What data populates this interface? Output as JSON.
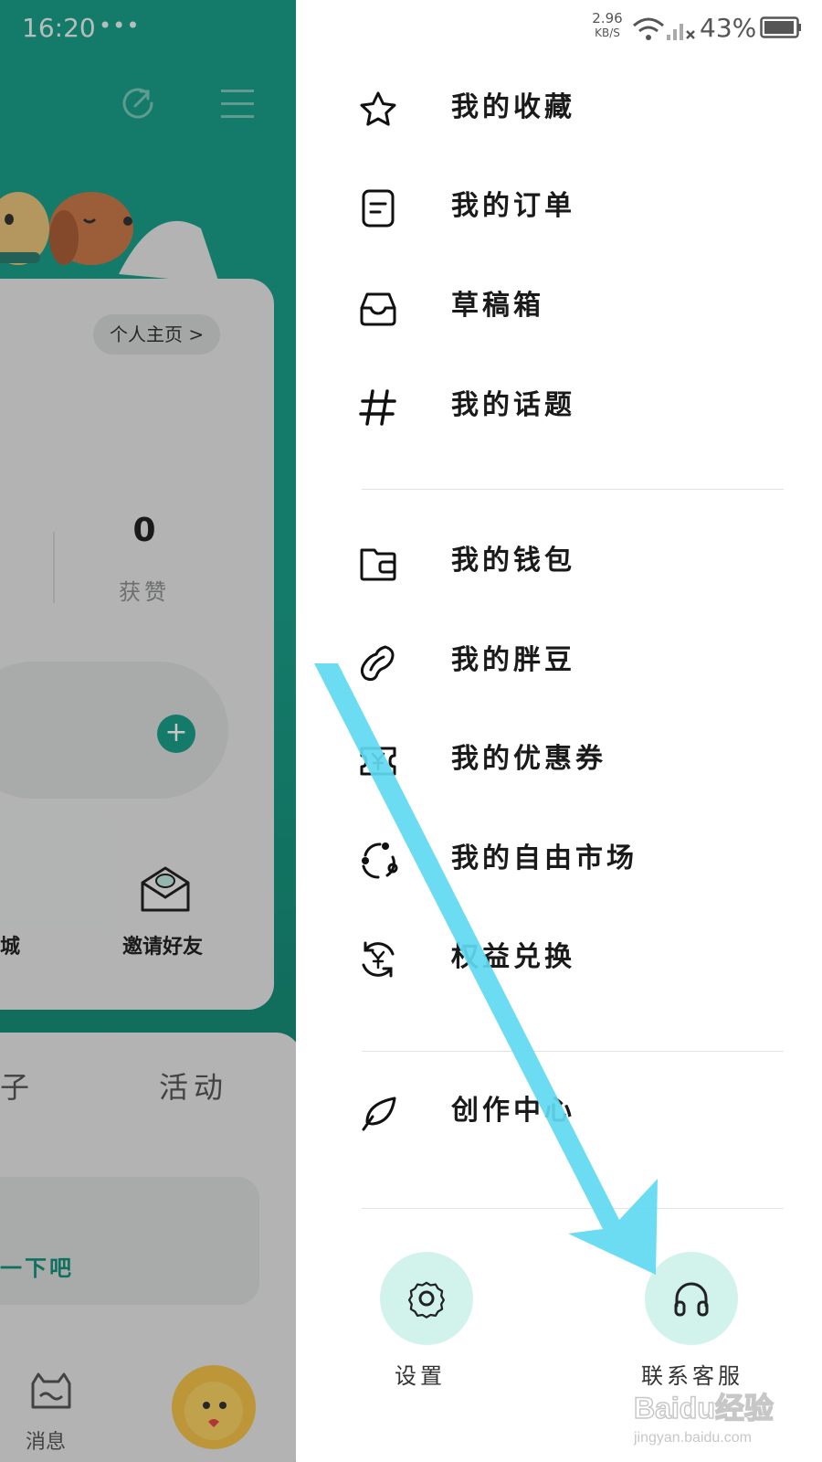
{
  "status_bar": {
    "time": "16:20",
    "dots": "•••",
    "net_speed_value": "2.96",
    "net_speed_unit": "KB/S",
    "battery": "43%"
  },
  "background_page": {
    "profile_link": "个人主页 >",
    "likes_count": "0",
    "likes_label": "获赞",
    "plus": "+",
    "mall_label": "城",
    "invite_label": "邀请好友",
    "tab_left": "子",
    "tab_activity": "活动",
    "empty_hint": "一下吧",
    "nav_message": "消息"
  },
  "drawer": {
    "items_group1": [
      {
        "label": "我的收藏",
        "icon": "star-icon"
      },
      {
        "label": "我的订单",
        "icon": "document-icon"
      },
      {
        "label": "草稿箱",
        "icon": "inbox-icon"
      },
      {
        "label": "我的话题",
        "icon": "hashtag-icon"
      }
    ],
    "items_group2": [
      {
        "label": "我的钱包",
        "icon": "wallet-icon"
      },
      {
        "label": "我的胖豆",
        "icon": "bean-icon"
      },
      {
        "label": "我的优惠券",
        "icon": "coupon-icon"
      },
      {
        "label": "我的自由市场",
        "icon": "market-cycle-icon"
      },
      {
        "label": "权益兑换",
        "icon": "yen-exchange-icon"
      }
    ],
    "items_group3": [
      {
        "label": "创作中心",
        "icon": "feather-icon"
      }
    ],
    "settings_label": "设置",
    "support_label": "联系客服"
  },
  "watermark": {
    "brand": "Baidu经验",
    "url": "jingyan.baidu.com"
  },
  "colors": {
    "teal": "#1a9e88",
    "mint": "#d2f3ec",
    "arrow": "#5fd9f2"
  }
}
